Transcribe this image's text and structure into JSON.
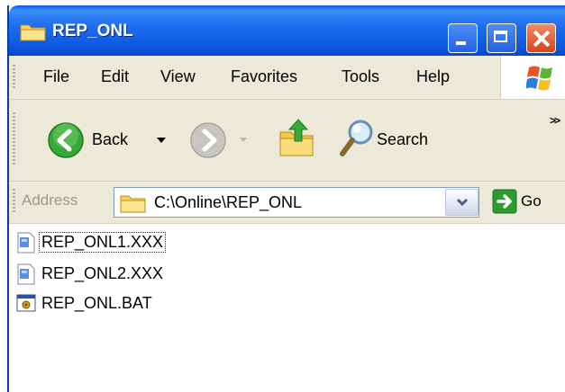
{
  "window": {
    "title": "REP_ONL"
  },
  "menu": {
    "items": [
      {
        "label": "File"
      },
      {
        "label": "Edit"
      },
      {
        "label": "View"
      },
      {
        "label": "Favorites"
      },
      {
        "label": "Tools"
      },
      {
        "label": "Help"
      }
    ]
  },
  "toolbar": {
    "back_label": "Back",
    "search_label": "Search",
    "overflow_label": ">>"
  },
  "address": {
    "label": "Address",
    "value": "C:\\Online\\REP_ONL",
    "go_label": "Go"
  },
  "files": [
    {
      "name": "REP_ONL1.XXX",
      "icon": "document-icon",
      "focused": true
    },
    {
      "name": "REP_ONL2.XXX",
      "icon": "document-icon",
      "focused": false
    },
    {
      "name": "REP_ONL.BAT",
      "icon": "batch-file-icon",
      "focused": false
    }
  ],
  "colors": {
    "titlebar": "#0b55dd",
    "close_button": "#d9431c",
    "chrome": "#ece9d8",
    "go_green": "#2e9b2e",
    "back_green": "#3aa839"
  }
}
